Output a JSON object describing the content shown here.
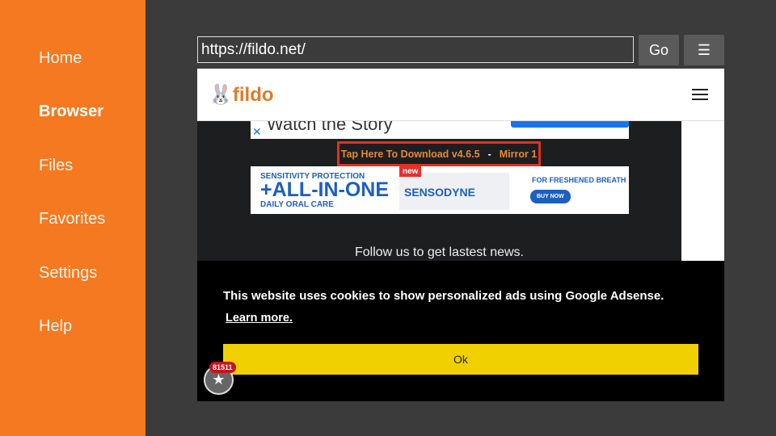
{
  "sidebar": {
    "items": [
      {
        "label": "Home"
      },
      {
        "label": "Browser",
        "active": true
      },
      {
        "label": "Files"
      },
      {
        "label": "Favorites"
      },
      {
        "label": "Settings"
      },
      {
        "label": "Help"
      }
    ]
  },
  "toolbar": {
    "url": "https://fildo.net/",
    "go_label": "Go",
    "menu_icon": "☰"
  },
  "page": {
    "logo": "fildo",
    "ad_top": "Watch the Story",
    "download": "Tap Here To Download v4.6.5",
    "sep": "-",
    "mirror": "Mirror 1",
    "ad": {
      "line1": "SENSITIVITY PROTECTION",
      "line2": "+ALL-IN-ONE",
      "line3": "DAILY ORAL CARE",
      "new": "new",
      "brand": "SENSODYNE",
      "fresh": "FOR FRESHENED BREATH",
      "buy": "BUY NOW"
    },
    "follow": "Follow us to get lastest news."
  },
  "cookie": {
    "text": "This website uses cookies to show personalized ads using Google Adsense.",
    "learn": "Learn more.",
    "ok": "Ok"
  },
  "cart": {
    "badge": "81511"
  },
  "colors": {
    "accent": "#f47920",
    "ok": "#f0d000",
    "highlight": "#e0321e"
  }
}
